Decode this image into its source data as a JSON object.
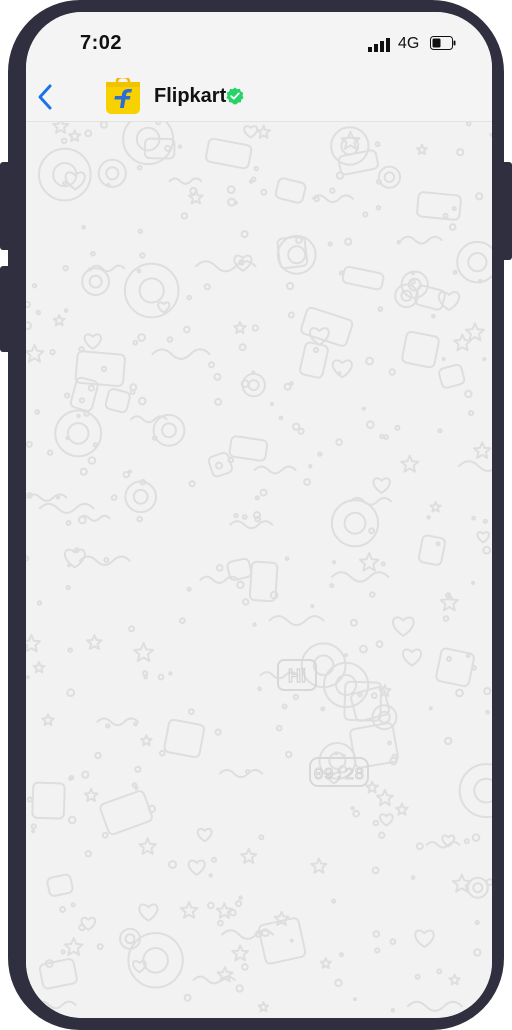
{
  "status_bar": {
    "time": "7:02",
    "network": "4G",
    "icons": [
      "signal-icon",
      "battery-icon"
    ]
  },
  "header": {
    "back_icon": "chevron-left-icon",
    "contact_name": "Flipkart",
    "avatar_icon": "flipkart-logo",
    "verified_icon": "verified-badge-icon"
  },
  "chat_background": {
    "style": "doodle-wallpaper",
    "doodle_texts": [
      "Hi",
      "09:28"
    ]
  },
  "colors": {
    "frame": "#2f2f3f",
    "accent_blue": "#1a73e8",
    "verified_green": "#25d366",
    "logo_yellow": "#f8d200",
    "wallpaper": "#f2f2f2",
    "doodle_stroke": "#dedede"
  }
}
